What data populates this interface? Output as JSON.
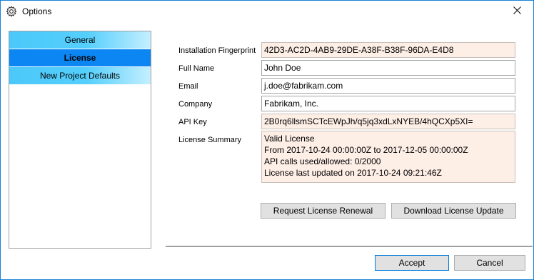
{
  "window": {
    "title": "Options",
    "icon": "gear-icon",
    "close_glyph": "✕"
  },
  "sidebar": {
    "items": [
      {
        "label": "General",
        "active": false
      },
      {
        "label": "License",
        "active": true
      },
      {
        "label": "New Project Defaults",
        "active": false
      }
    ]
  },
  "form": {
    "fingerprint": {
      "label": "Installation Fingerprint",
      "value": "42D3-AC2D-4AB9-29DE-A38F-B38F-96DA-E4D8"
    },
    "full_name": {
      "label": "Full Name",
      "value": "John Doe"
    },
    "email": {
      "label": "Email",
      "value": "j.doe@fabrikam.com"
    },
    "company": {
      "label": "Company",
      "value": "Fabrikam, Inc."
    },
    "api_key": {
      "label": "API Key",
      "value": "2B0rq6llsmSCTcEWpJh/q5jq3xdLxNYEB/4hQCXp5XI="
    },
    "summary": {
      "label": "License Summary",
      "lines": [
        "Valid License",
        "From 2017-10-24 00:00:00Z to 2017-12-05 00:00:00Z",
        "API calls used/allowed: 0/2000",
        "License last updated on 2017-10-24 09:21:46Z"
      ]
    }
  },
  "actions": {
    "renew_label": "Request License Renewal",
    "download_label": "Download License Update"
  },
  "footer": {
    "accept_label": "Accept",
    "cancel_label": "Cancel"
  },
  "colors": {
    "accent": "#0078d7",
    "selected_item": "#0b86f2",
    "nav_gradient": "#4bc8fa",
    "readonly_field": "#fdeee6",
    "button_face": "#e1e1e1"
  }
}
